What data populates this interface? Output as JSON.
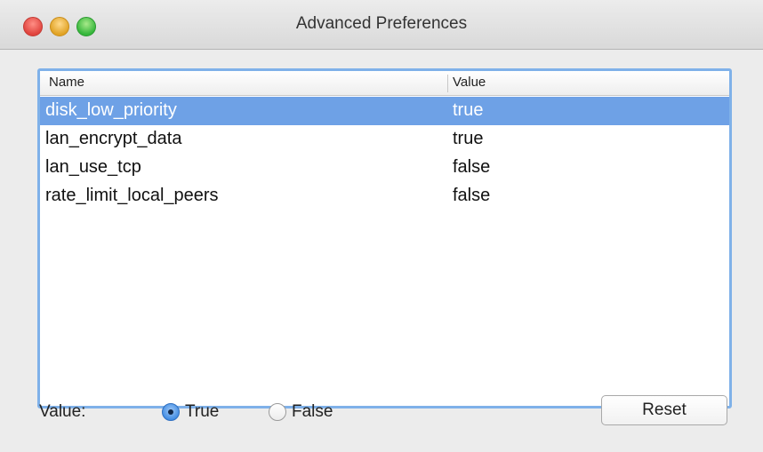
{
  "window": {
    "title": "Advanced Preferences"
  },
  "table": {
    "columns": {
      "name": "Name",
      "value": "Value"
    },
    "rows": [
      {
        "name": "disk_low_priority",
        "value": "true",
        "selected": true
      },
      {
        "name": "lan_encrypt_data",
        "value": "true",
        "selected": false
      },
      {
        "name": "lan_use_tcp",
        "value": "false",
        "selected": false
      },
      {
        "name": "rate_limit_local_peers",
        "value": "false",
        "selected": false
      }
    ],
    "selection_color": "#6ea1e6"
  },
  "controls": {
    "value_label": "Value:",
    "radio_true_label": "True",
    "radio_false_label": "False",
    "selected_value": "True",
    "reset_label": "Reset"
  }
}
